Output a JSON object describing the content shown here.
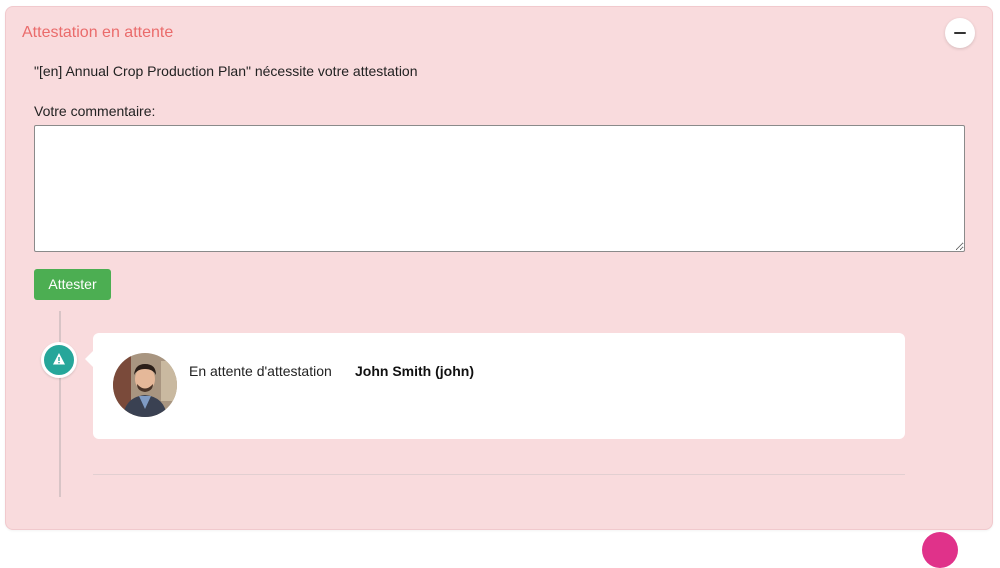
{
  "panel": {
    "title": "Attestation en attente",
    "message": "\"[en] Annual Crop Production Plan\" nécessite votre attestation",
    "comment_label": "Votre commentaire:",
    "comment_value": "",
    "attest_button": "Attester"
  },
  "timeline": {
    "entries": [
      {
        "status": "En attente d'attestation",
        "user": "John Smith (john)",
        "icon": "warning-icon"
      }
    ]
  },
  "colors": {
    "panel_bg": "#f9dbdd",
    "title": "#ea6b6b",
    "attest_button": "#4cae52",
    "timeline_icon": "#26a69a"
  }
}
